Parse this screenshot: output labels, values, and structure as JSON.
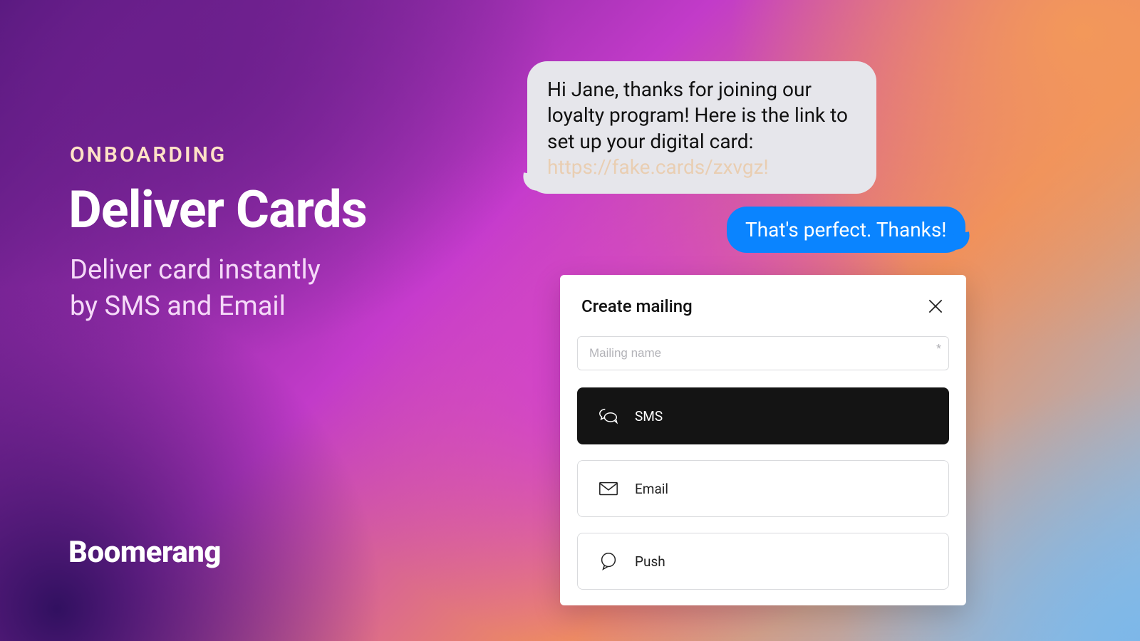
{
  "hero": {
    "eyebrow": "ONBOARDING",
    "title": "Deliver Cards",
    "subtitle_line1": "Deliver card instantly",
    "subtitle_line2": "by SMS and Email"
  },
  "brand": "Boomerang",
  "chat": {
    "incoming_text": "Hi Jane, thanks for joining our loyalty program! Here is the link to set up your digital card:",
    "incoming_link": "https://fake.cards/zxvgz!",
    "outgoing_text": "That's perfect. Thanks!"
  },
  "panel": {
    "title": "Create mailing",
    "input_placeholder": "Mailing name",
    "required_mark": "*",
    "options": {
      "sms": "SMS",
      "email": "Email",
      "push": "Push"
    }
  }
}
